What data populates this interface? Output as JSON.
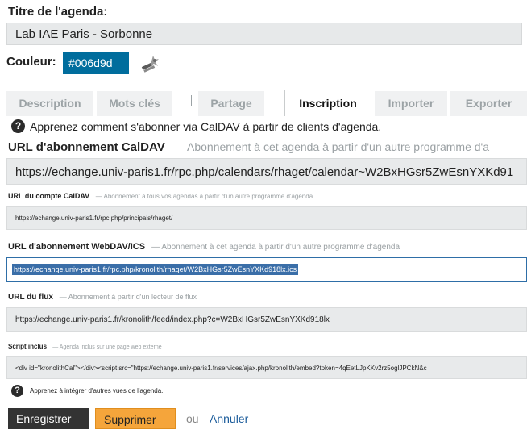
{
  "form": {
    "title_label": "Titre de l'agenda:",
    "title_value": "Lab IAE Paris - Sorbonne",
    "color_label": "Couleur:",
    "color_value": "#006d9d"
  },
  "tabs": [
    {
      "label": "Description",
      "active": false
    },
    {
      "label": "Mots clés",
      "active": false
    },
    {
      "label": "Partage",
      "active": false
    },
    {
      "label": "Inscription",
      "active": true
    },
    {
      "label": "Importer",
      "active": false
    },
    {
      "label": "Exporter",
      "active": false
    }
  ],
  "help": {
    "icon": "question-icon",
    "text": "Apprenez comment s'abonner via CalDAV à partir de clients d'agenda."
  },
  "sections": {
    "caldav": {
      "title": "URL d'abonnement CalDAV",
      "desc": "— Abonnement à cet agenda à partir d'un autre programme d'a",
      "url": "https://echange.univ-paris1.fr/rpc.php/calendars/rhaget/calendar~W2BxHGsr5ZwEsnYXKd91"
    },
    "account": {
      "title": "URL du compte CalDAV",
      "desc": "— Abonnement à tous vos agendas à partir d'un autre programme d'agenda",
      "url": "https://echange.univ-paris1.fr/rpc.php/principals/rhaget/"
    },
    "webdav": {
      "title": "URL d'abonnement WebDAV/ICS",
      "desc": "— Abonnement à cet agenda à partir d'un autre programme d'agenda",
      "url": "https://echange.univ-paris1.fr/rpc.php/kronolith/rhaget/W2BxHGsr5ZwEsnYXKd918lx.ics"
    },
    "feed": {
      "title": "URL du flux",
      "desc": "— Abonnement à partir d'un lecteur de flux",
      "url": "https://echange.univ-paris1.fr/kronolith/feed/index.php?c=W2BxHGsr5ZwEsnYXKd918lx"
    },
    "script": {
      "title": "Script inclus",
      "desc": "— Agenda inclus sur une page web externe",
      "url": "<div id=\"kronolithCal\"></div><script src=\"https://echange.univ-paris1.fr/services/ajax.php/kronolith/embed?token=4qEetLJpKKv2rz5oglJPCkN&c"
    }
  },
  "help2": {
    "icon": "question-icon",
    "text": "Apprenez à intégrer d'autres vues de l'agenda."
  },
  "actions": {
    "save": "Enregistrer",
    "delete": "Supprimer",
    "or": "ou",
    "cancel": "Annuler"
  },
  "colors": {
    "accent": "#006d9d",
    "save_bg": "#333333",
    "delete_bg": "#f5a53b",
    "link": "#1a5b9a"
  }
}
